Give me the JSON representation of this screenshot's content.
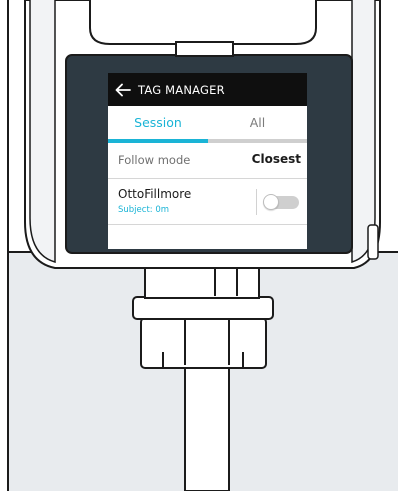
{
  "header": {
    "title": "TAG MANAGER",
    "back_icon": "arrow-left-icon"
  },
  "tabs": [
    {
      "label": "Session",
      "active": true
    },
    {
      "label": "All",
      "active": false
    }
  ],
  "follow_mode": {
    "label": "Follow mode",
    "value": "Closest"
  },
  "subject": {
    "name": "OttoFillmore",
    "distance": "Subject: 0m",
    "toggle_on": false
  },
  "colors": {
    "accent": "#1ab4d6",
    "titlebar": "#0f0f0f",
    "bezel": "#2e3a43",
    "floor": "#e8ebee"
  }
}
